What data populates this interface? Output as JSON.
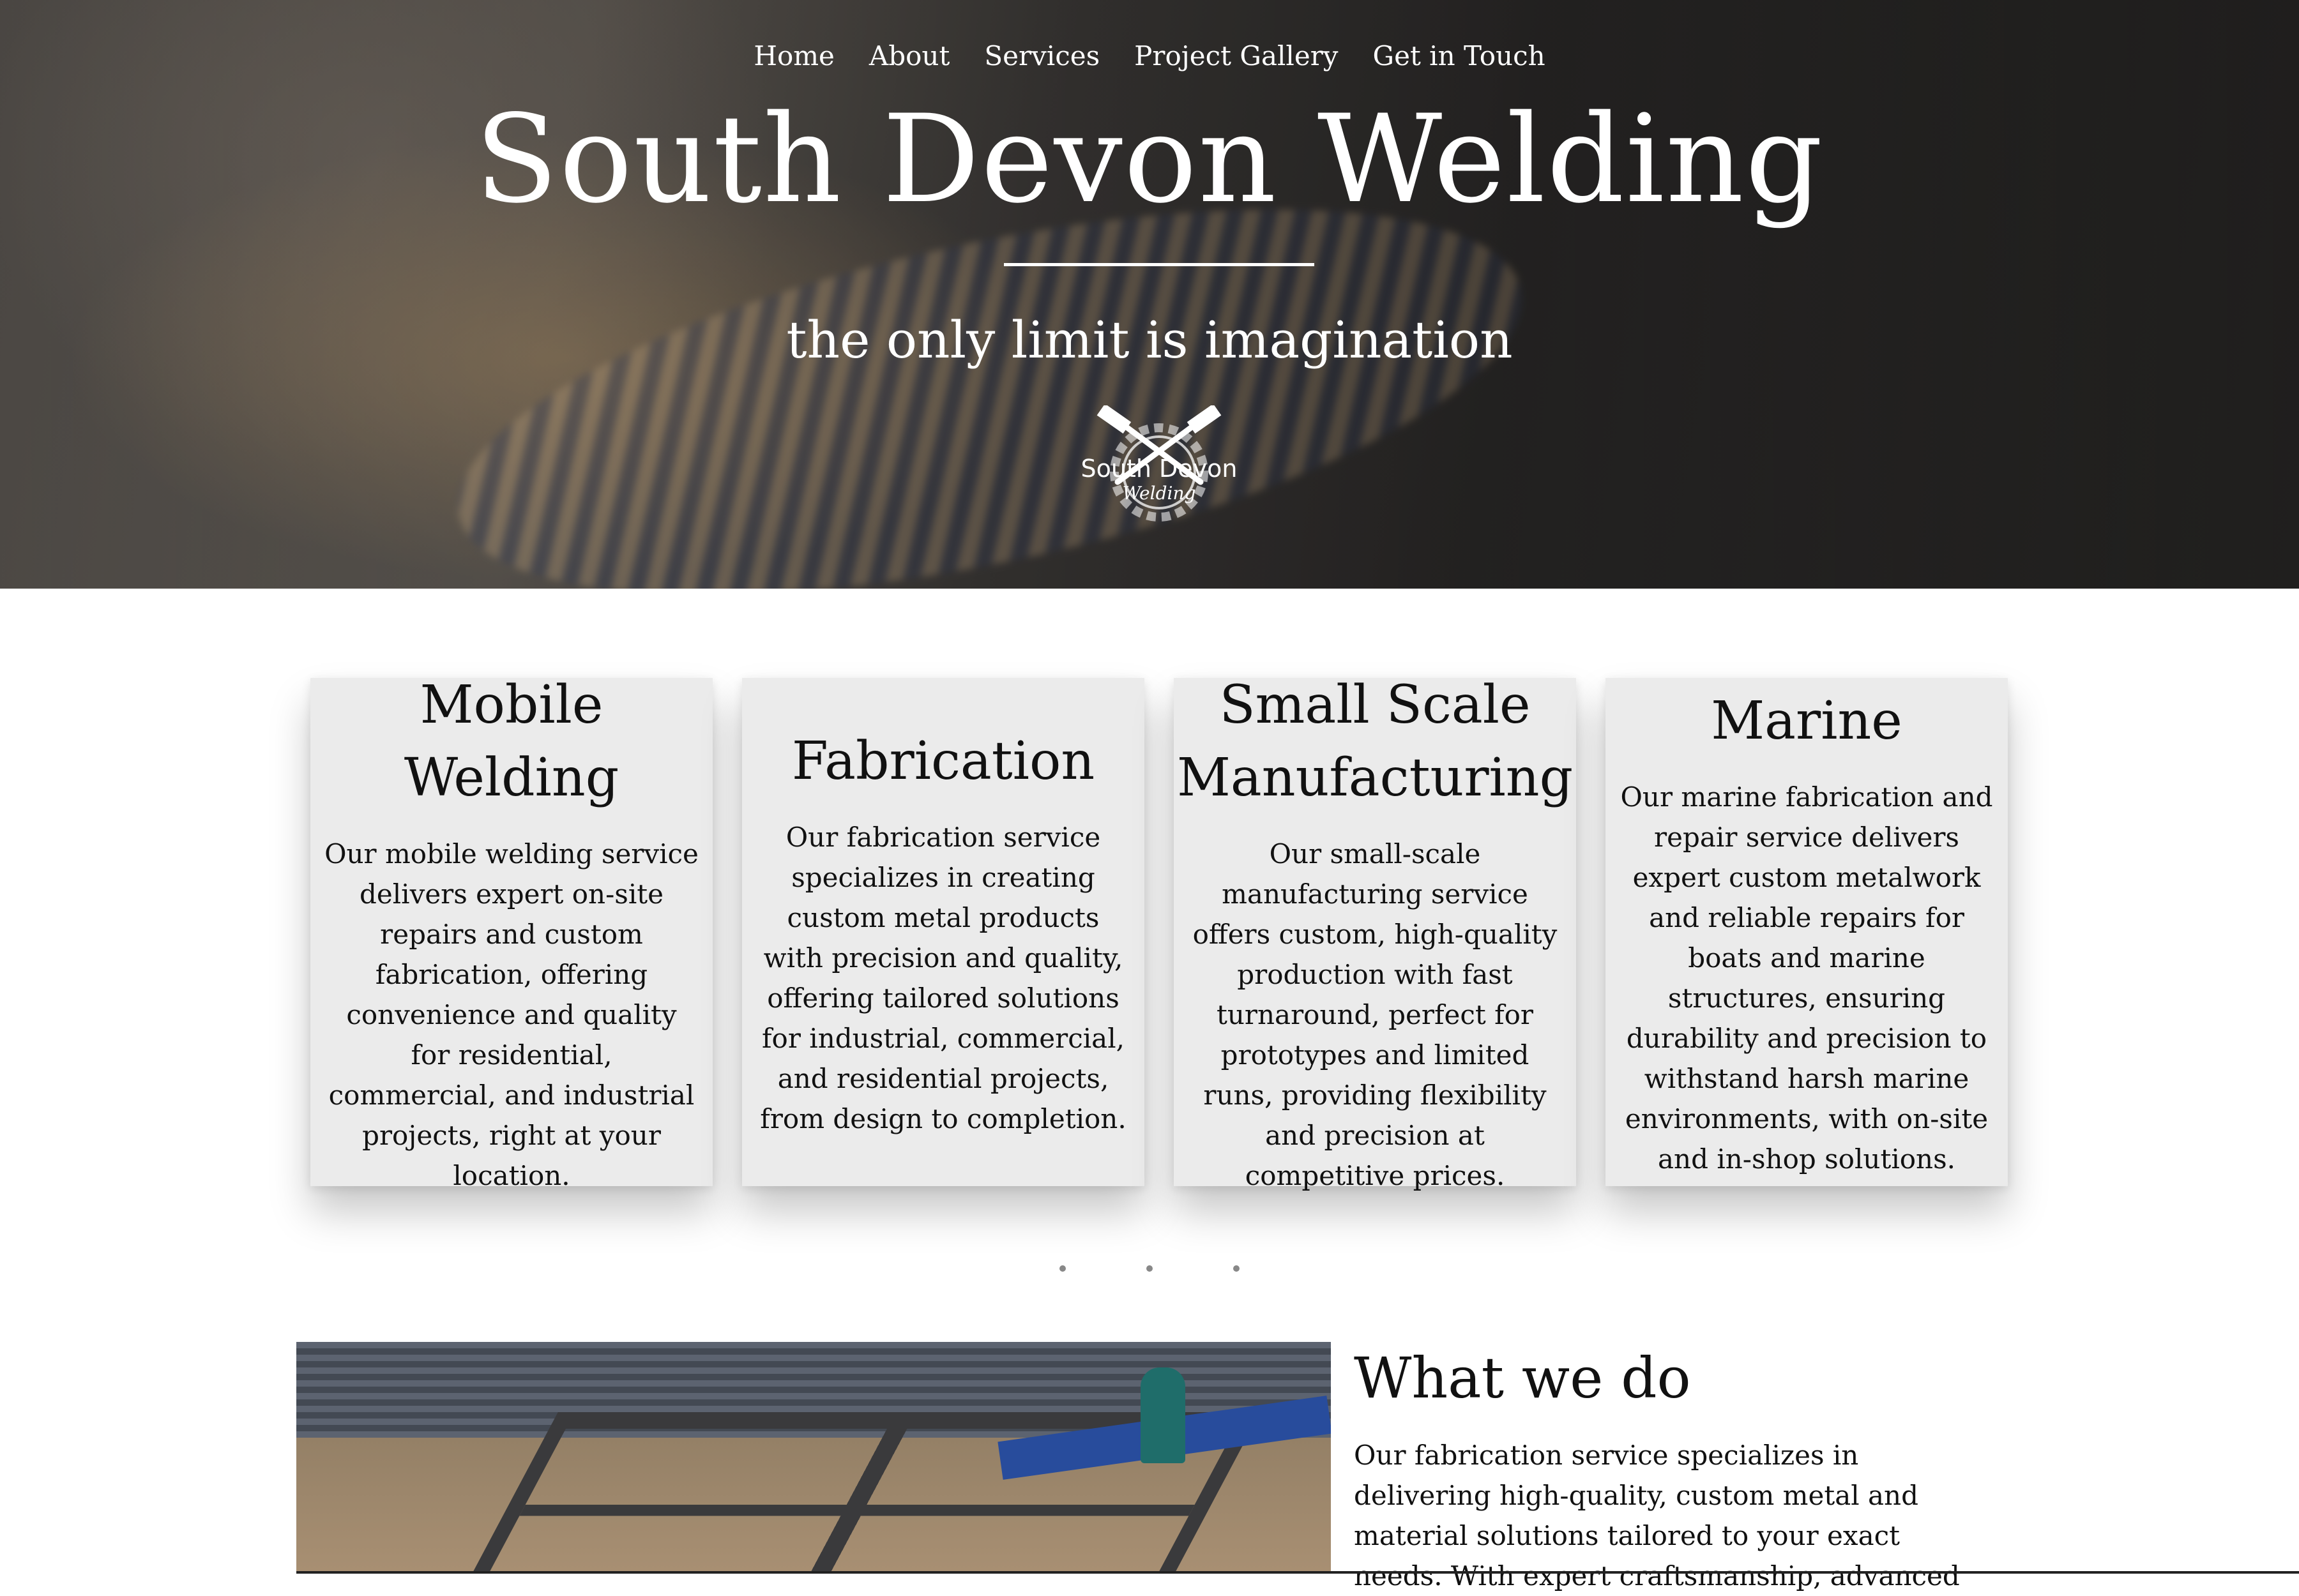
{
  "nav": {
    "items": [
      "Home",
      "About",
      "Services",
      "Project Gallery",
      "Get in Touch"
    ]
  },
  "hero": {
    "title": "South Devon Welding",
    "tagline": "the only limit is imagination",
    "logo_text_line1": "South Devon",
    "logo_text_line2": "Welding"
  },
  "services": [
    {
      "title": "Mobile Welding",
      "text": "Our mobile welding service delivers expert on-site repairs and custom fabrication, offering convenience and quality for residential, commercial, and industrial projects, right at your location."
    },
    {
      "title": "Fabrication",
      "text": "Our fabrication service specializes in creating custom metal products with precision and quality, offering tailored solutions for industrial, commercial, and residential projects, from design to completion."
    },
    {
      "title": "Small Scale Manufacturing",
      "text": "Our small-scale manufacturing service offers custom, high-quality production with fast turnaround, perfect for prototypes and limited runs, providing flexibility and precision at competitive prices."
    },
    {
      "title": "Marine",
      "text": "Our marine fabrication and repair service delivers expert custom metalwork and reliable repairs for boats and marine structures, ensuring durability and precision to withstand harsh marine environments, with on-site and in-shop solutions."
    }
  ],
  "carousel": {
    "dot_count": 3
  },
  "what_we_do": {
    "title": "What we do",
    "text": "Our fabrication service specializes in delivering high-quality, custom metal and material solutions tailored to your exact needs. With expert craftsmanship, advanced"
  },
  "colors": {
    "card_background": "#ebebeb",
    "hero_text": "#ffffff",
    "body_text": "#111111"
  }
}
